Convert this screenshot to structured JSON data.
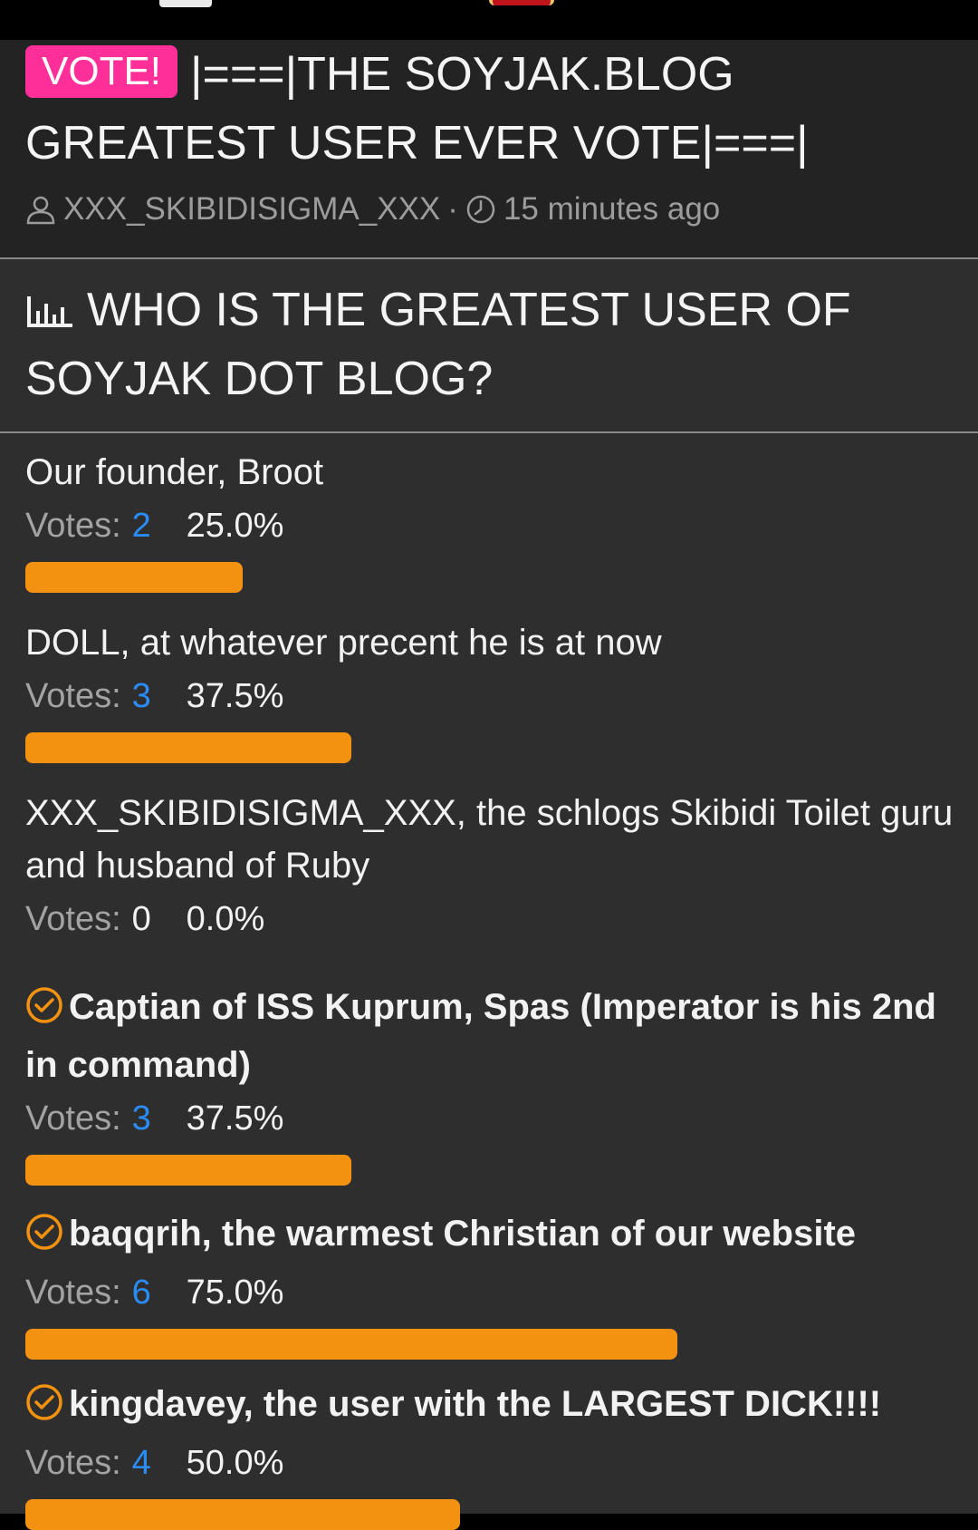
{
  "post": {
    "badge": "VOTE!",
    "title": "|===|THE SOYJAK.BLOG GREATEST USER EVER VOTE|===|",
    "author": "XXX_SKIBIDISIGMA_XXX",
    "separator": "·",
    "time": "15 minutes ago"
  },
  "poll": {
    "question": "WHO IS THE GREATEST USER OF SOYJAK DOT BLOG?",
    "votes_label": "Votes:",
    "options": [
      {
        "label": "Our founder, Broot",
        "votes": "2",
        "percent": "25.0%",
        "fraction": 0.25,
        "selected": false
      },
      {
        "label": "DOLL, at whatever precent he is at now",
        "votes": "3",
        "percent": "37.5%",
        "fraction": 0.375,
        "selected": false
      },
      {
        "label": "XXX_SKIBIDISIGMA_XXX, the schlogs Skibidi Toilet guru and husband of Ruby",
        "votes": "0",
        "percent": "0.0%",
        "fraction": 0,
        "selected": false
      },
      {
        "label": "Captian of ISS Kuprum, Spas (Imperator is his 2nd in command)",
        "votes": "3",
        "percent": "37.5%",
        "fraction": 0.375,
        "selected": true
      },
      {
        "label": "baqqrih, the warmest Christian of our website",
        "votes": "6",
        "percent": "75.0%",
        "fraction": 0.75,
        "selected": true
      },
      {
        "label": "kingdavey, the user with the LARGEST DICK!!!!",
        "votes": "4",
        "percent": "50.0%",
        "fraction": 0.5,
        "selected": true
      }
    ]
  },
  "colors": {
    "bar": "#f39210",
    "badge": "#ff2f9a",
    "vote_count": "#2a8cf4",
    "check": "#f39210"
  },
  "icons": [
    "user-icon",
    "clock-icon",
    "poll-chart-icon",
    "check-circle-icon"
  ]
}
